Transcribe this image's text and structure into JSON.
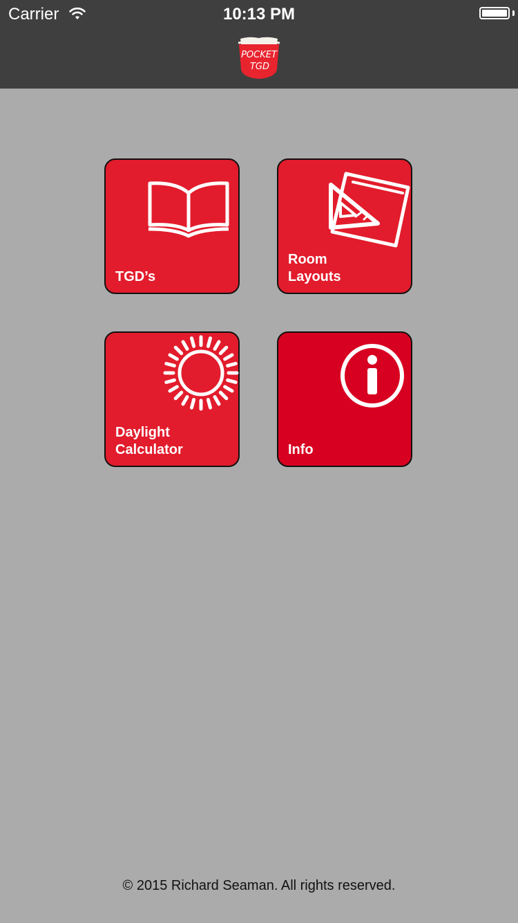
{
  "status_bar": {
    "carrier": "Carrier",
    "time": "10:13 PM",
    "wifi_icon": "wifi-icon",
    "battery_icon": "battery-icon"
  },
  "header": {
    "logo_icon": "pocket-tgd-logo",
    "logo_line1": "POCKET",
    "logo_line2": "TGD"
  },
  "tiles": [
    {
      "lines": [
        "TGD’s"
      ],
      "icon": "open-book-icon"
    },
    {
      "lines": [
        "Room",
        "Layouts"
      ],
      "icon": "set-square-icon"
    },
    {
      "lines": [
        "Daylight",
        "Calculator"
      ],
      "icon": "sun-icon"
    },
    {
      "lines": [
        "Info"
      ],
      "icon": "info-icon"
    }
  ],
  "footer": {
    "copyright": "© 2015 Richard Seaman. All rights reserved."
  },
  "colors": {
    "header_bg": "#3f3f3f",
    "page_bg": "#ababab",
    "tile_red": "#e21c2c",
    "info_red": "#d80020"
  }
}
